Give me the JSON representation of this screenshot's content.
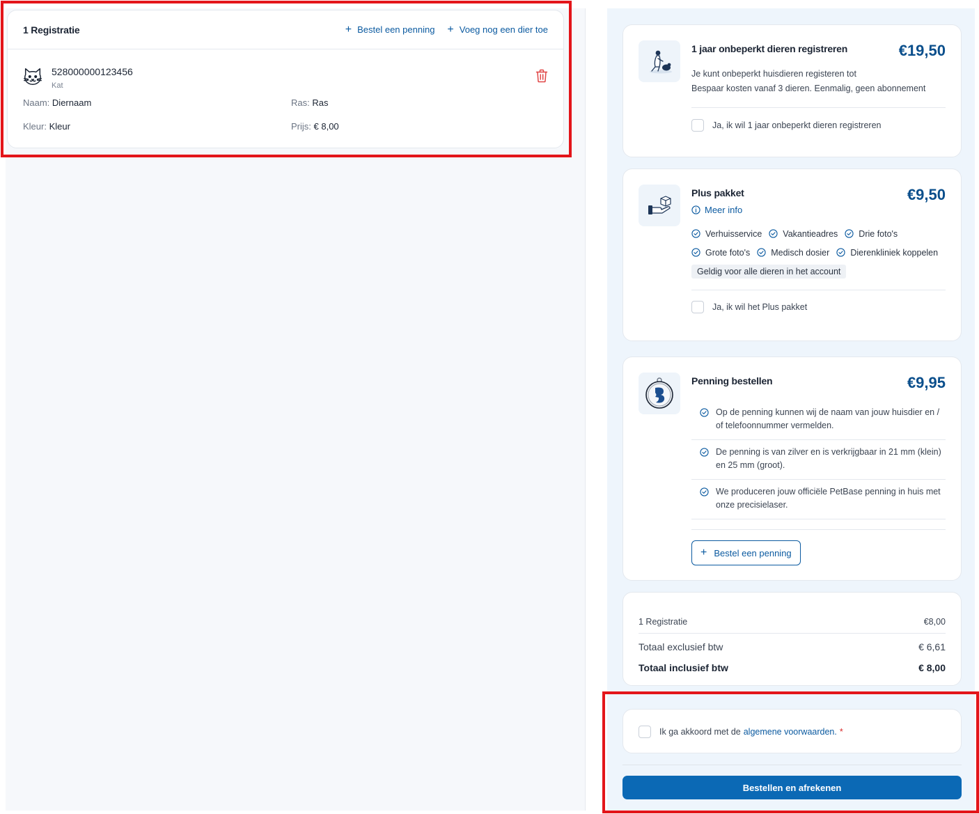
{
  "registration": {
    "title": "1 Registratie",
    "order_tag_label": "Bestel een penning",
    "add_animal_label": "Voeg nog een dier toe",
    "pet": {
      "chip": "528000000123456",
      "species": "Kat",
      "name_label": "Naam:",
      "name_value": "Diernaam",
      "breed_label": "Ras:",
      "breed_value": "Ras",
      "color_label": "Kleur:",
      "color_value": "Kleur",
      "price_label": "Prijs:",
      "price_value": "€ 8,00"
    }
  },
  "unlimited": {
    "title": "1 jaar onbeperkt dieren registreren",
    "price": "€19,50",
    "desc_line1": "Je kunt onbeperkt huisdieren registeren tot",
    "desc_line2": "Bespaar kosten vanaf 3 dieren. Eenmalig, geen abonnement",
    "checkbox_label": "Ja, ik wil 1 jaar onbeperkt dieren registreren"
  },
  "plus": {
    "title": "Plus pakket",
    "price": "€9,50",
    "more_info": "Meer info",
    "features": [
      "Verhuisservice",
      "Vakantieadres",
      "Drie foto's",
      "Grote foto's",
      "Medisch dosier",
      "Dierenkliniek koppelen"
    ],
    "badge": "Geldig voor alle dieren in het account",
    "checkbox_label": "Ja, ik wil het Plus pakket"
  },
  "tag": {
    "title": "Penning bestellen",
    "price": "€9,95",
    "items": [
      "Op de penning kunnen wij de naam van jouw huisdier en / of telefoonnummer vermelden.",
      "De penning is van zilver en is verkrijgbaar in 21 mm (klein) en 25 mm (groot).",
      "We produceren jouw officiële PetBase penning in huis met onze precisielaser."
    ],
    "button_label": "Bestel een penning"
  },
  "summary": {
    "line_label": "1 Registratie",
    "line_value": "€8,00",
    "excl_label": "Totaal exclusief btw",
    "excl_value": "€ 6,61",
    "incl_label": "Totaal inclusief btw",
    "incl_value": "€ 8,00"
  },
  "terms": {
    "text": "Ik ga akkoord met de",
    "link": "algemene voorwaarden.",
    "required_mark": "*"
  },
  "checkout_label": "Bestellen en afrekenen",
  "colors": {
    "accent": "#0b69b5",
    "link": "#0b5aa0",
    "price": "#0b4f8c",
    "danger": "#e3151a"
  }
}
